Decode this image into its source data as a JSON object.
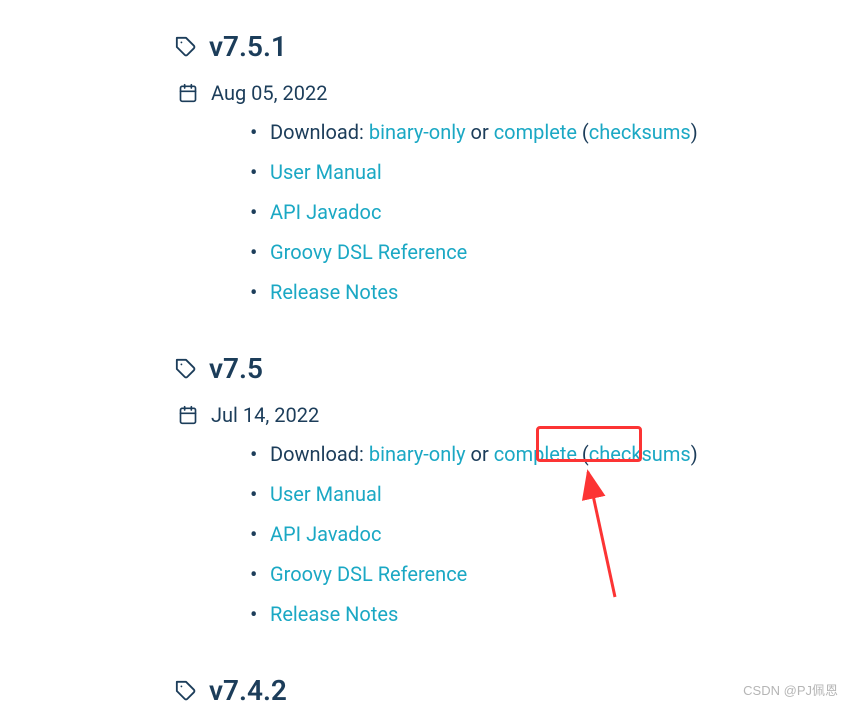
{
  "releases": [
    {
      "version": "v7.5.1",
      "date": "Aug 05, 2022",
      "download_label": "Download: ",
      "binary_only": "binary-only",
      "or_text": " or ",
      "complete": "complete",
      "open_paren": " (",
      "checksums": "checksums",
      "close_paren": ")",
      "user_manual": "User Manual",
      "api_javadoc": "API Javadoc",
      "groovy_dsl": "Groovy DSL Reference",
      "release_notes": "Release Notes"
    },
    {
      "version": "v7.5",
      "date": "Jul 14, 2022",
      "download_label": "Download: ",
      "binary_only": "binary-only",
      "or_text": " or ",
      "complete": "complete",
      "open_paren": " (",
      "checksums": "checksums",
      "close_paren": ")",
      "user_manual": "User Manual",
      "api_javadoc": "API Javadoc",
      "groovy_dsl": "Groovy DSL Reference",
      "release_notes": "Release Notes"
    },
    {
      "version": "v7.4.2"
    }
  ],
  "watermark": "CSDN @PJ佩恩"
}
